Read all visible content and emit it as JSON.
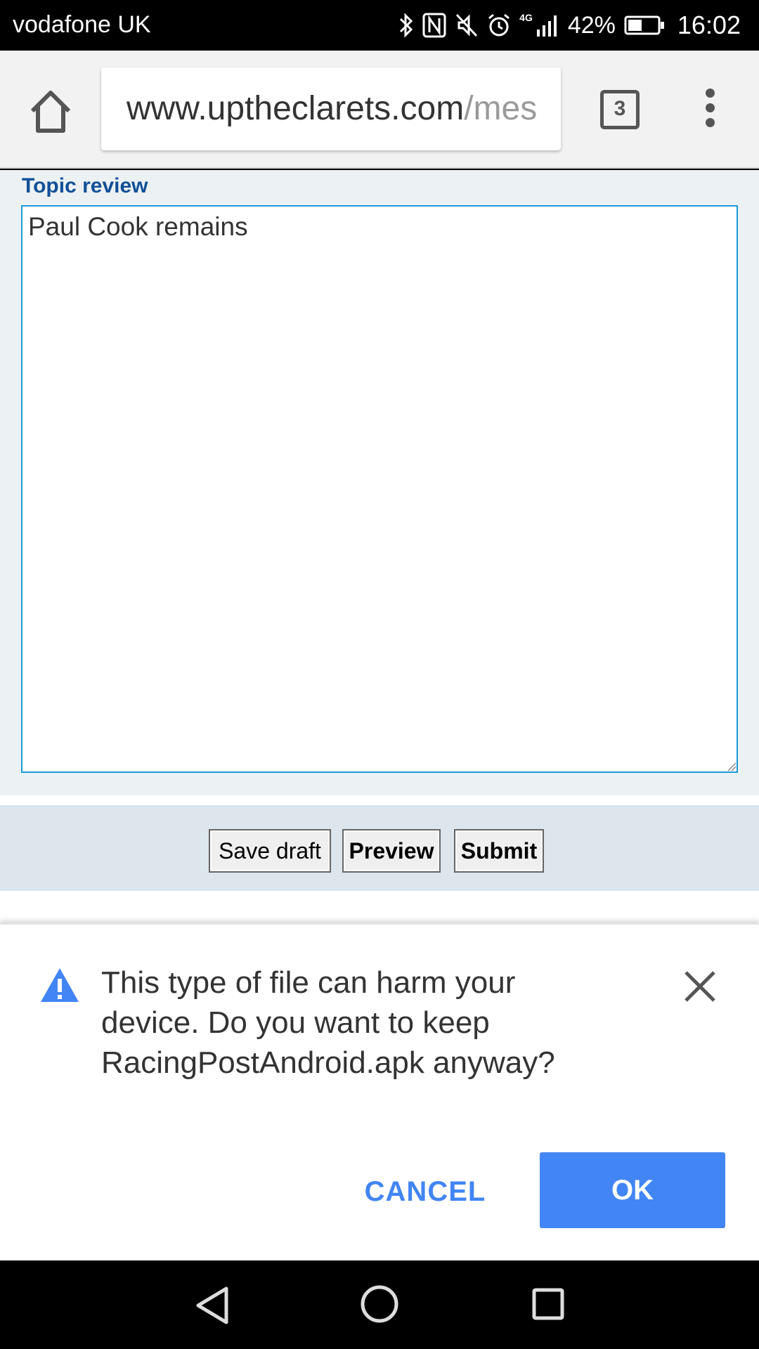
{
  "status_bar": {
    "carrier": "vodafone UK",
    "network": "4G",
    "battery_percent": "42%",
    "time": "16:02",
    "icons": [
      "bluetooth-icon",
      "nfc-icon",
      "vibrate-mute-icon",
      "alarm-icon",
      "signal-icon",
      "battery-icon"
    ]
  },
  "browser": {
    "url_host": "www.uptheclarets.com",
    "url_path": "/mes",
    "tab_count": "3"
  },
  "page": {
    "section_title": "Topic review",
    "message_text": "Paul Cook remains",
    "buttons": {
      "save_draft": "Save draft",
      "preview": "Preview",
      "submit": "Submit"
    }
  },
  "download_warning": {
    "message": "This type of file can harm your device. Do you want to keep RacingPostAndroid.apk anyway?",
    "cancel_label": "CANCEL",
    "ok_label": "OK",
    "accent_color": "#4285f4"
  },
  "colors": {
    "section_title": "#115098",
    "textarea_border": "#1b9bd7",
    "panel_bg": "#ecf1f3",
    "button_bar_bg": "#dce6ec"
  }
}
